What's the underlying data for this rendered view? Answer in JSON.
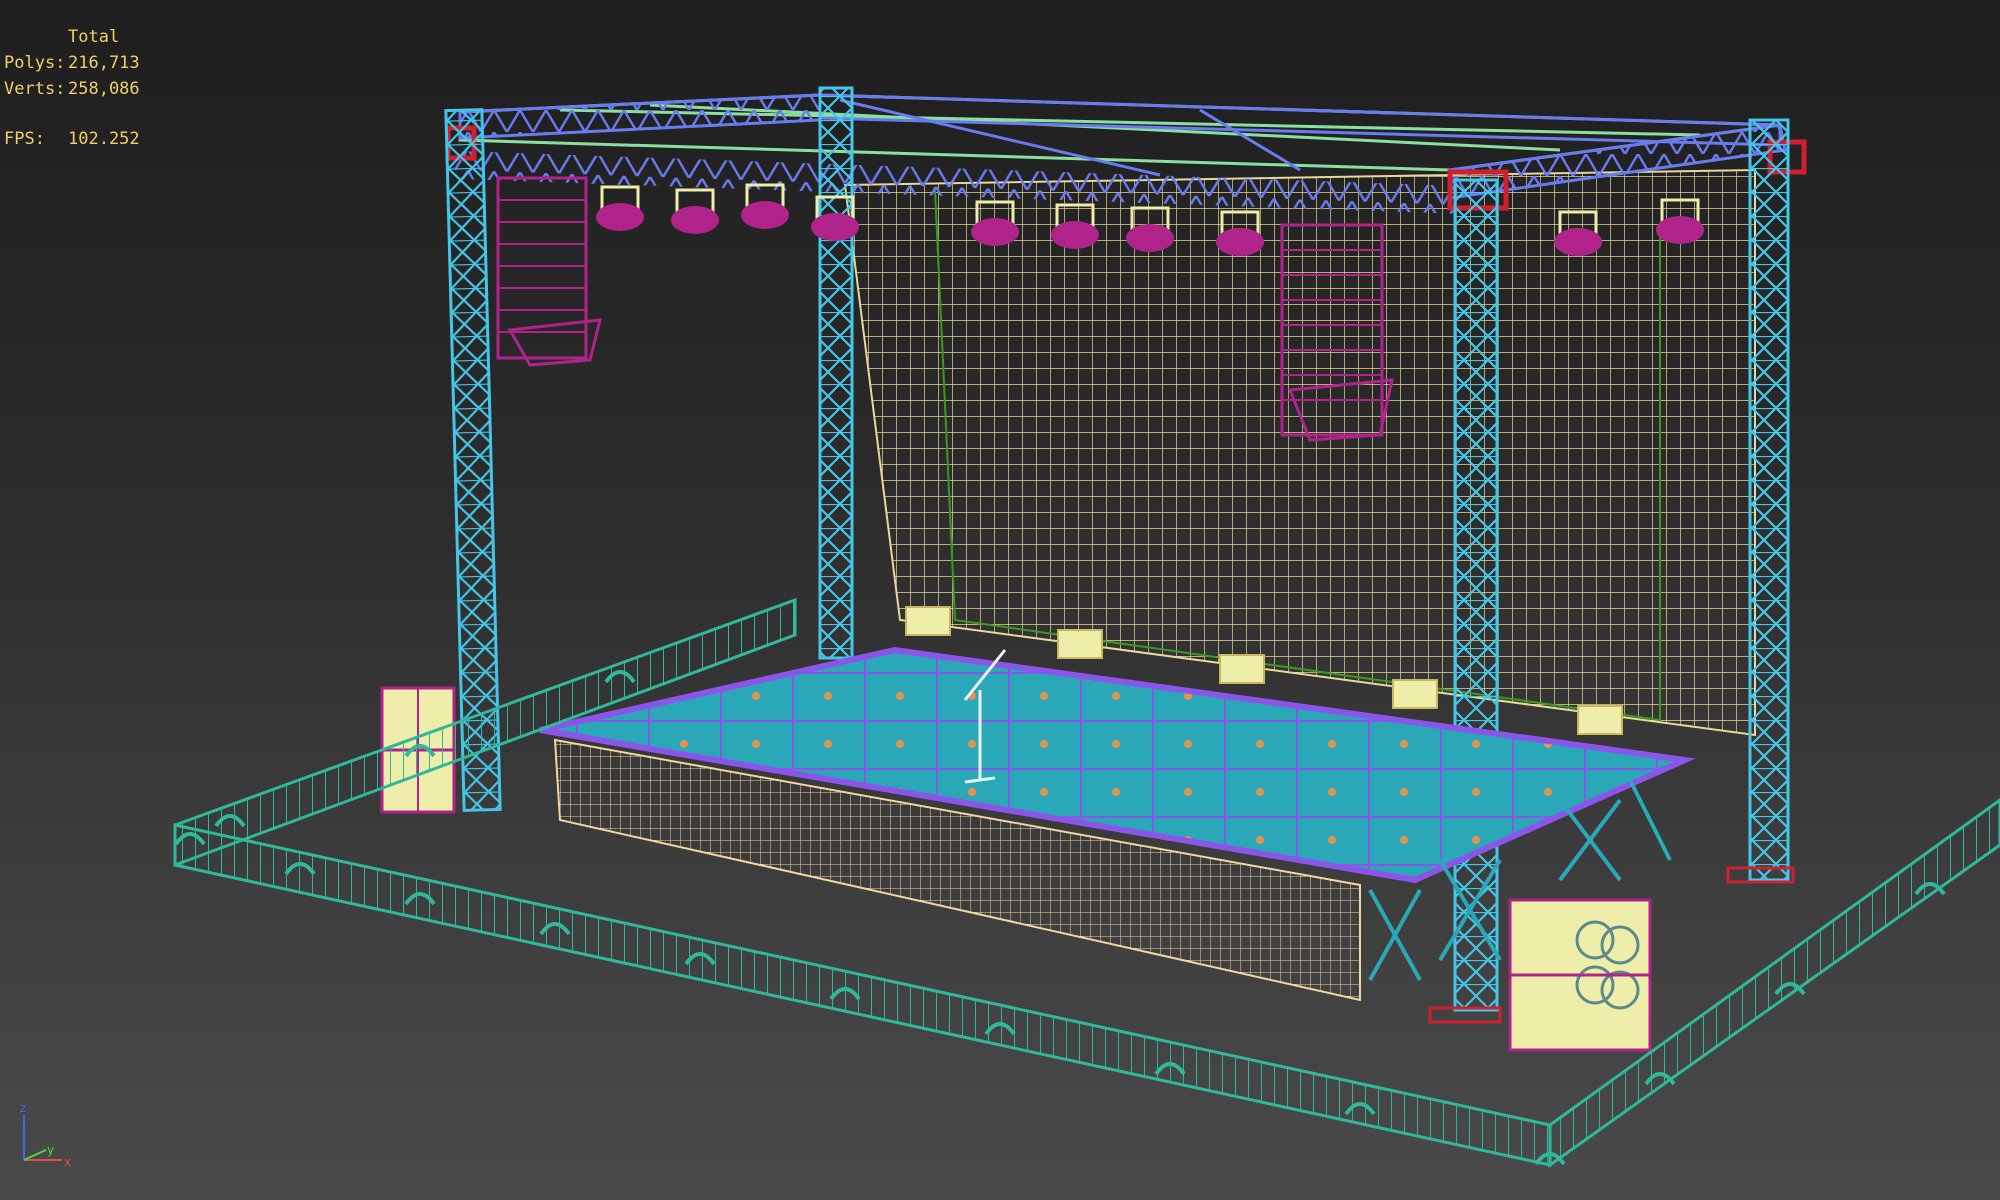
{
  "stats": {
    "header": "Total",
    "polys_label": "Polys:",
    "polys_value": "216,713",
    "verts_label": "Verts:",
    "verts_value": "258,086",
    "fps_label": "FPS:",
    "fps_value": "102.252"
  },
  "axis_gizmo": {
    "z": "z",
    "x": "x",
    "y": "y"
  },
  "colors": {
    "background_top": "#1e1e1e",
    "background_bottom": "#4a4a4a",
    "stats_text": "#f0d06a",
    "barrier": "#2fb89a",
    "truss_column": "#45c6e8",
    "truss_top": "#6a7bf0",
    "truss_top_green": "#8ae0a0",
    "net": "#e8d89a",
    "speaker": "#b0238a",
    "deck_frame": "#8a55e8",
    "deck_panel": "#2aa8b8",
    "cabinet": "#eeeeaa",
    "clamp": "#d02030"
  }
}
